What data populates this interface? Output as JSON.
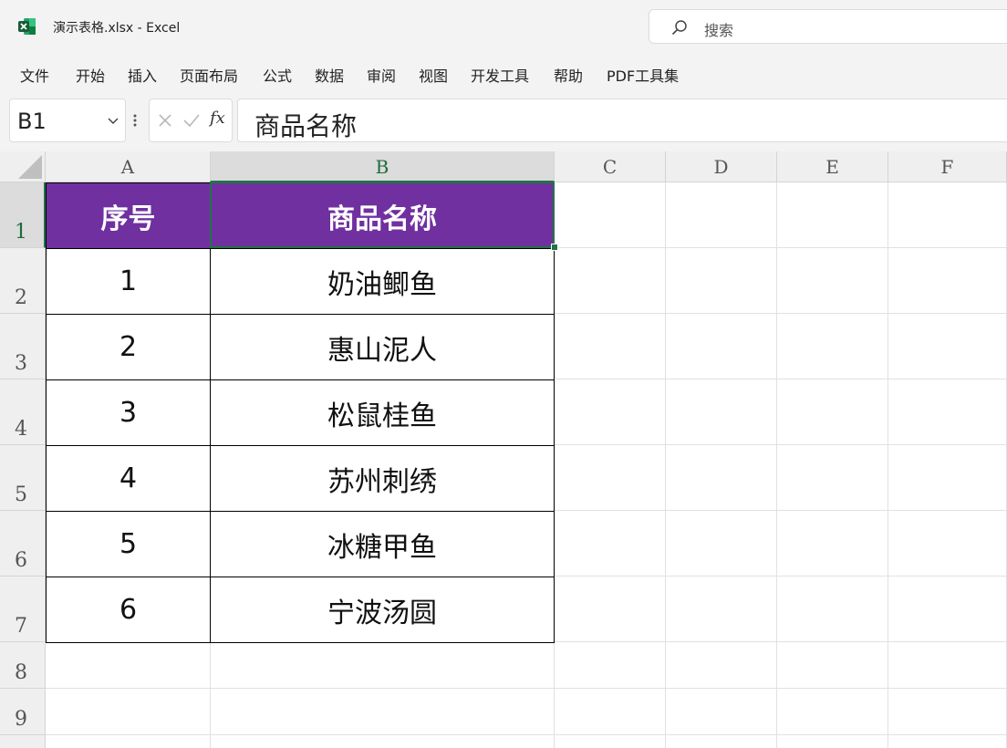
{
  "window": {
    "title": "演示表格.xlsx  -  Excel",
    "search_placeholder": "搜索"
  },
  "menu": [
    "文件",
    "开始",
    "插入",
    "页面布局",
    "公式",
    "数据",
    "审阅",
    "视图",
    "开发工具",
    "帮助",
    "PDF工具集"
  ],
  "formula_bar": {
    "name_box": "B1",
    "fx_label": "fx",
    "content": "商品名称"
  },
  "columns": [
    "A",
    "B",
    "C",
    "D",
    "E",
    "F"
  ],
  "rows": [
    "1",
    "2",
    "3",
    "4",
    "5",
    "6",
    "7",
    "8",
    "9"
  ],
  "selected_cell": "B1",
  "colors": {
    "header_fill": "#7030a0",
    "selection": "#217346"
  },
  "table": {
    "headers": [
      "序号",
      "商品名称"
    ],
    "rows": [
      [
        "1",
        "奶油鲫鱼"
      ],
      [
        "2",
        "惠山泥人"
      ],
      [
        "3",
        "松鼠桂鱼"
      ],
      [
        "4",
        "苏州刺绣"
      ],
      [
        "5",
        "冰糖甲鱼"
      ],
      [
        "6",
        "宁波汤圆"
      ]
    ]
  }
}
